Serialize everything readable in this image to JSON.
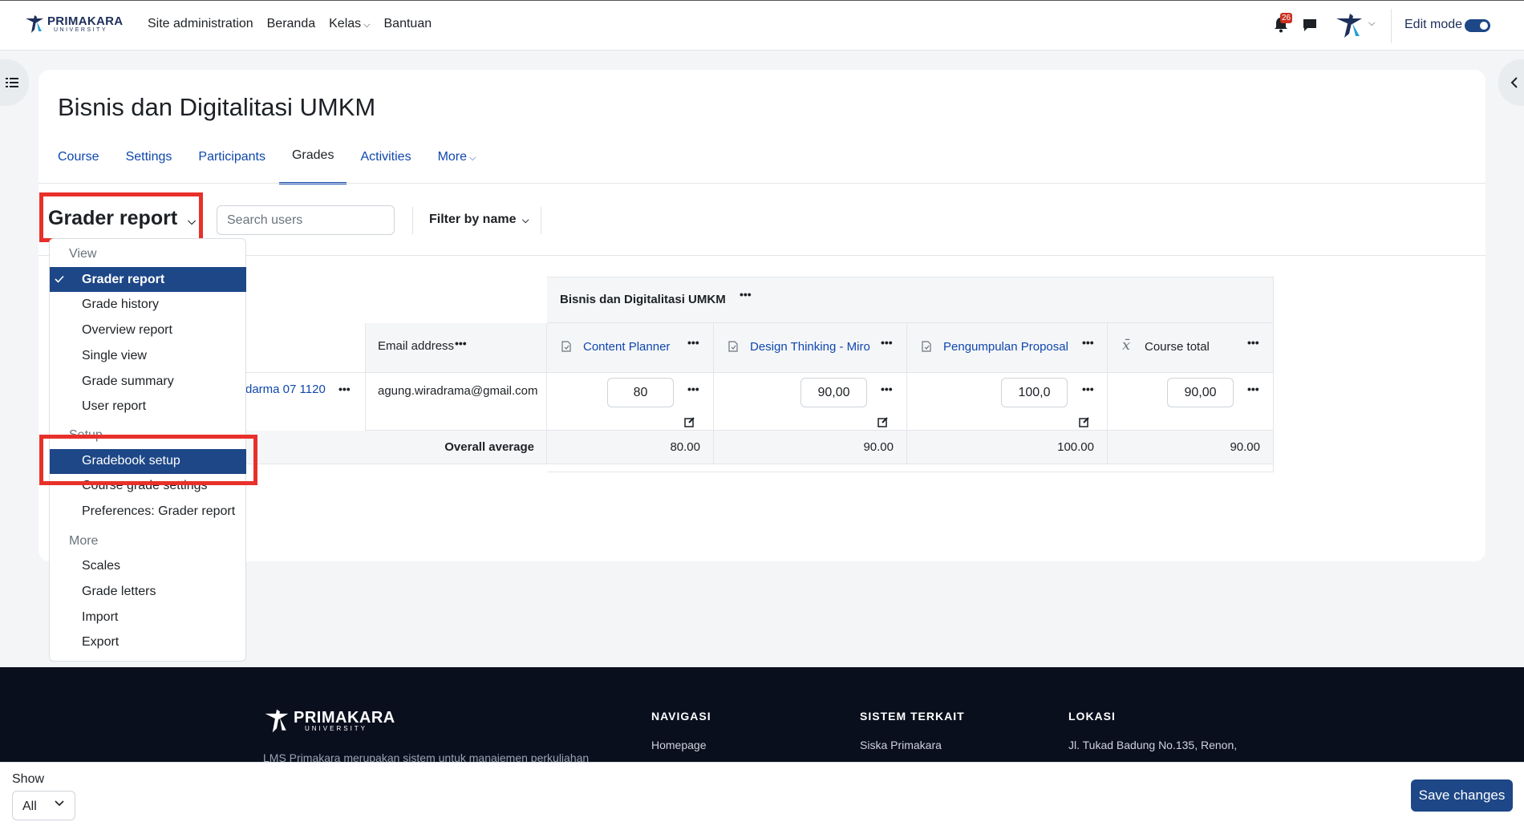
{
  "navbar": {
    "brand_name": "PRIMAKARA",
    "brand_sub": "UNIVERSITY",
    "items": [
      "Site administration",
      "Beranda",
      "Kelas",
      "Bantuan"
    ],
    "notification_count": "26",
    "edit_mode_label": "Edit mode"
  },
  "page": {
    "title": "Bisnis dan Digitalitasi UMKM",
    "tabs": [
      "Course",
      "Settings",
      "Participants",
      "Grades",
      "Activities",
      "More"
    ]
  },
  "report": {
    "selector_label": "Grader report",
    "search_placeholder": "Search users",
    "filter_label": "Filter by name"
  },
  "dropdown": {
    "view_header": "View",
    "view_items": [
      "Grader report",
      "Grade history",
      "Overview report",
      "Single view",
      "Grade summary",
      "User report"
    ],
    "setup_header": "Setup",
    "setup_items": [
      "Gradebook setup",
      "Course grade settings",
      "Preferences: Grader report"
    ],
    "more_header": "More",
    "more_items": [
      "Scales",
      "Grade letters",
      "Import",
      "Export"
    ]
  },
  "table": {
    "category_name": "Bisnis dan Digitalitasi UMKM",
    "email_header": "Email address",
    "columns": [
      "Content Planner",
      "Design Thinking - Miro",
      "Pengumpulan Proposal",
      "Course total"
    ],
    "student": {
      "name_partial": "darma 07 1120",
      "email": "agung.wiradrama@gmail.com",
      "grades": [
        "80",
        "90,00",
        "100,0",
        "90,00"
      ]
    },
    "overall_label": "Overall average",
    "averages": [
      "80.00",
      "90.00",
      "100.00",
      "90.00"
    ]
  },
  "footer": {
    "brand_name": "PRIMAKARA",
    "brand_sub": "UNIVERSITY",
    "description": "LMS Primakara merupakan sistem untuk manajemen perkuliahan",
    "nav_header": "NAVIGASI",
    "nav_link": "Homepage",
    "related_header": "SISTEM TERKAIT",
    "related_link": "Siska Primakara",
    "location_header": "LOKASI",
    "location_text": "Jl. Tukad Badung No.135, Renon,"
  },
  "bottombar": {
    "show_label": "Show",
    "show_value": "All",
    "save_label": "Save changes"
  },
  "colors": {
    "primary": "#1d4787",
    "link": "#0f47ad",
    "highlight": "#e8302a",
    "footer_bg": "#0a0f1e"
  }
}
